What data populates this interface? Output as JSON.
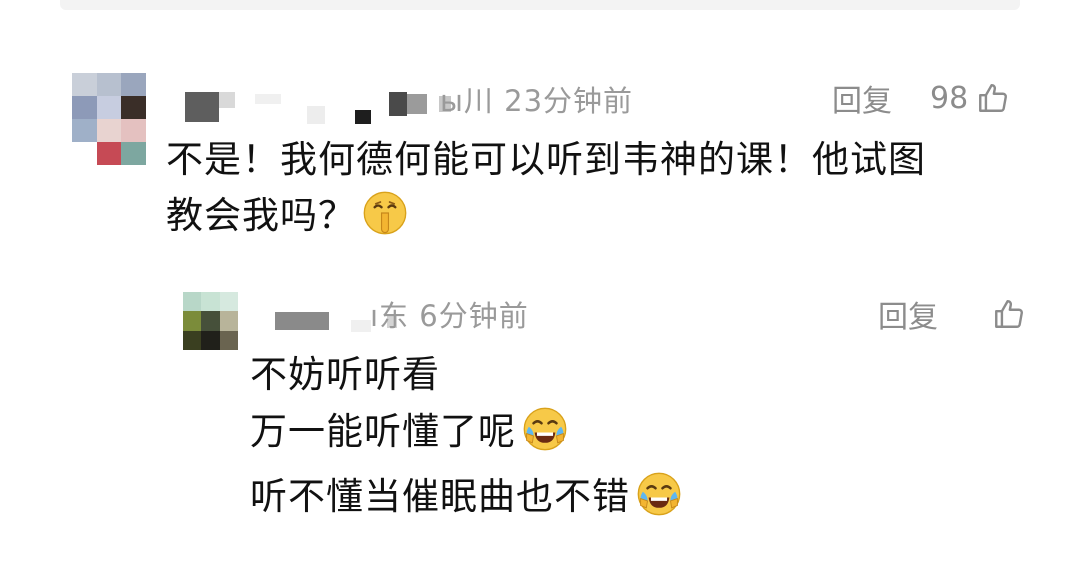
{
  "comments": [
    {
      "location_time": "ы川 23分钟前",
      "reply_label": "回复",
      "like_count": "98",
      "lines": [
        "不是！我何德何能可以听到韦神的课！他试图",
        "教会我吗？"
      ],
      "line_emojis": [
        "",
        "shushing-face-emoji"
      ],
      "replies": [
        {
          "location_time": "ı东 6分钟前",
          "reply_label": "回复",
          "like_count": "",
          "lines": [
            "不妨听听看",
            "万一能听懂了呢",
            "听不懂当催眠曲也不错"
          ],
          "line_emojis": [
            "",
            "laughing-crying-emoji",
            "laughing-crying-emoji"
          ]
        }
      ]
    }
  ],
  "colors": {
    "text_primary": "#111111",
    "text_meta": "#9a9a9a",
    "action": "#8c8c8c",
    "emoji_face": "#f7c948"
  }
}
